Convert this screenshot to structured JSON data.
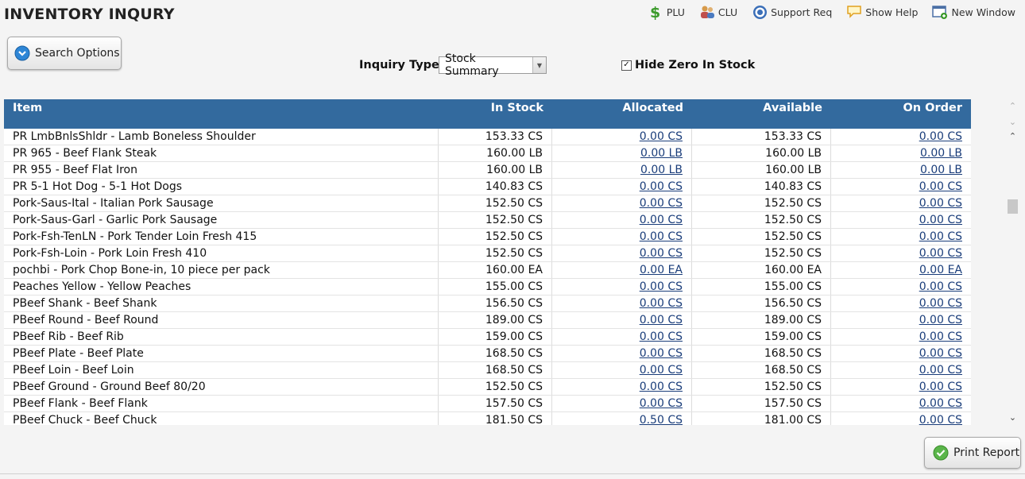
{
  "page_title": "INVENTORY INQURY",
  "toplinks": {
    "plu": "PLU",
    "clu": "CLU",
    "support": "Support Req",
    "help": "Show Help",
    "new_window": "New Window"
  },
  "search_button": "Search Options",
  "inquiry": {
    "label": "Inquiry Type",
    "value": "Stock Summary"
  },
  "hide_zero": {
    "label": "Hide Zero In Stock",
    "checked": true
  },
  "columns": [
    "Item",
    "In Stock",
    "Allocated",
    "Available",
    "On Order"
  ],
  "rows": [
    {
      "item": "PR LmbBnlsShldr - Lamb Boneless Shoulder",
      "in_stock": "153.33 CS",
      "allocated": "0.00 CS",
      "available": "153.33 CS",
      "on_order": "0.00 CS"
    },
    {
      "item": "PR 965 - Beef Flank Steak",
      "in_stock": "160.00 LB",
      "allocated": "0.00 LB",
      "available": "160.00 LB",
      "on_order": "0.00 LB"
    },
    {
      "item": "PR 955 - Beef Flat Iron",
      "in_stock": "160.00 LB",
      "allocated": "0.00 LB",
      "available": "160.00 LB",
      "on_order": "0.00 LB"
    },
    {
      "item": "PR 5-1 Hot Dog - 5-1 Hot Dogs",
      "in_stock": "140.83 CS",
      "allocated": "0.00 CS",
      "available": "140.83 CS",
      "on_order": "0.00 CS"
    },
    {
      "item": "Pork-Saus-Ital - Italian Pork Sausage",
      "in_stock": "152.50 CS",
      "allocated": "0.00 CS",
      "available": "152.50 CS",
      "on_order": "0.00 CS"
    },
    {
      "item": "Pork-Saus-Garl - Garlic Pork Sausage",
      "in_stock": "152.50 CS",
      "allocated": "0.00 CS",
      "available": "152.50 CS",
      "on_order": "0.00 CS"
    },
    {
      "item": "Pork-Fsh-TenLN - Pork Tender Loin Fresh 415",
      "in_stock": "152.50 CS",
      "allocated": "0.00 CS",
      "available": "152.50 CS",
      "on_order": "0.00 CS"
    },
    {
      "item": "Pork-Fsh-Loin - Pork Loin Fresh 410",
      "in_stock": "152.50 CS",
      "allocated": "0.00 CS",
      "available": "152.50 CS",
      "on_order": "0.00 CS"
    },
    {
      "item": "pochbi - Pork Chop Bone-in, 10 piece per pack",
      "in_stock": "160.00 EA",
      "allocated": "0.00 EA",
      "available": "160.00 EA",
      "on_order": "0.00 EA"
    },
    {
      "item": "Peaches Yellow - Yellow Peaches",
      "in_stock": "155.00 CS",
      "allocated": "0.00 CS",
      "available": "155.00 CS",
      "on_order": "0.00 CS"
    },
    {
      "item": "PBeef Shank - Beef Shank",
      "in_stock": "156.50 CS",
      "allocated": "0.00 CS",
      "available": "156.50 CS",
      "on_order": "0.00 CS"
    },
    {
      "item": "PBeef Round - Beef Round",
      "in_stock": "189.00 CS",
      "allocated": "0.00 CS",
      "available": "189.00 CS",
      "on_order": "0.00 CS"
    },
    {
      "item": "PBeef Rib - Beef Rib",
      "in_stock": "159.00 CS",
      "allocated": "0.00 CS",
      "available": "159.00 CS",
      "on_order": "0.00 CS"
    },
    {
      "item": "PBeef Plate - Beef Plate",
      "in_stock": "168.50 CS",
      "allocated": "0.00 CS",
      "available": "168.50 CS",
      "on_order": "0.00 CS"
    },
    {
      "item": "PBeef Loin - Beef Loin",
      "in_stock": "168.50 CS",
      "allocated": "0.00 CS",
      "available": "168.50 CS",
      "on_order": "0.00 CS"
    },
    {
      "item": "PBeef Ground - Ground Beef 80/20",
      "in_stock": "152.50 CS",
      "allocated": "0.00 CS",
      "available": "152.50 CS",
      "on_order": "0.00 CS"
    },
    {
      "item": "PBeef Flank - Beef Flank",
      "in_stock": "157.50 CS",
      "allocated": "0.00 CS",
      "available": "157.50 CS",
      "on_order": "0.00 CS"
    },
    {
      "item": "PBeef Chuck - Beef Chuck",
      "in_stock": "181.50 CS",
      "allocated": "0.50 CS",
      "available": "181.00 CS",
      "on_order": "0.00 CS"
    }
  ],
  "print_button": "Print Report",
  "colors": {
    "header_bg": "#336a9e",
    "link": "#1a3d7a",
    "page_bg": "#f4f4f4"
  }
}
